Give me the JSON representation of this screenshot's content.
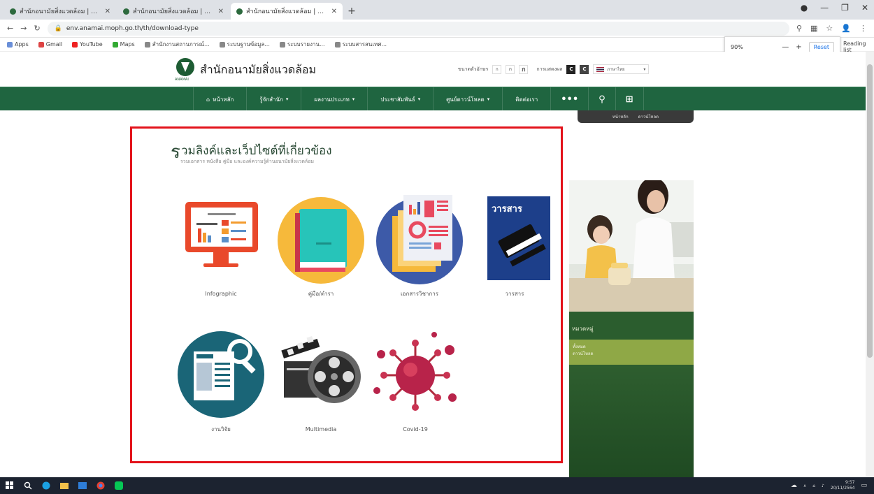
{
  "browser": {
    "tabs": [
      {
        "title": "สำนักอนามัยสิ่งแวดล้อม | หน้าหลัก",
        "active": false
      },
      {
        "title": "สำนักอนามัยสิ่งแวดล้อม | หน้าหลัก",
        "active": false
      },
      {
        "title": "สำนักอนามัยสิ่งแวดล้อม | Website",
        "active": true
      }
    ],
    "url": "env.anamai.moph.go.th/th/download-type",
    "bookmarks": [
      "Apps",
      "Gmail",
      "YouTube",
      "Maps",
      "สำนักงานสถานการณ์...",
      "ระบบฐานข้อมูล...",
      "ระบบรายงาน...",
      "ระบบสารสนเทศ..."
    ],
    "zoom": {
      "value": "90%",
      "reset_label": "Reset"
    },
    "reading_list": "Reading list"
  },
  "site": {
    "title": "สำนักอนามัยสิ่งแวดล้อม",
    "logo_sub": "ANAMAI",
    "font_size_label": "ขนาดตัวอักษร",
    "font_sizes": [
      "ก",
      "ก",
      "ก"
    ],
    "contrast_label": "การแสดงผล",
    "contrast": [
      "C",
      "C"
    ],
    "language": "ภาษาไทย"
  },
  "nav": {
    "items": [
      {
        "label": "หน้าหลัก",
        "icon": "home-icon",
        "dropdown": false
      },
      {
        "label": "รู้จักสำนัก",
        "dropdown": true
      },
      {
        "label": "ผลงานประเภท",
        "dropdown": true
      },
      {
        "label": "ประชาสัมพันธ์",
        "dropdown": true
      },
      {
        "label": "ศูนย์ดาวน์โหลด",
        "dropdown": true
      },
      {
        "label": "ติดต่อเรา",
        "dropdown": false
      }
    ],
    "sub_links": [
      "หน้าหลัก",
      "ดาวน์โหลด"
    ]
  },
  "section": {
    "title_initial": "ร",
    "title_rest": "วมลิงค์และเว็ปไซต์ที่เกี่ยวข้อง",
    "subtitle": "รวมเอกสาร หนังสือ คู่มือ และองค์ความรู้ด้านอนามัยสิ่งแวดล้อม",
    "tiles": [
      {
        "label": "Infographic",
        "icon": "infographic-monitor-icon"
      },
      {
        "label": "คู่มือ/ตำรา",
        "icon": "book-icon"
      },
      {
        "label": "เอกสารวิชาการ",
        "icon": "documents-chart-icon"
      },
      {
        "label": "วารสาร",
        "icon": "journal-icon",
        "badge": "วารสาร"
      },
      {
        "label": "งานวิจัย",
        "icon": "research-search-icon",
        "badge": "งานวิจัย"
      },
      {
        "label": "Multimedia",
        "icon": "film-reel-icon"
      },
      {
        "label": "Covid-19",
        "icon": "coronavirus-icon"
      }
    ]
  },
  "sidebar": {
    "title": "หมวดหมู่",
    "items": [
      "ทั้งหมด",
      "ดาวน์โหลด"
    ]
  },
  "taskbar": {
    "time": "9:57",
    "date": "20/11/2564"
  }
}
